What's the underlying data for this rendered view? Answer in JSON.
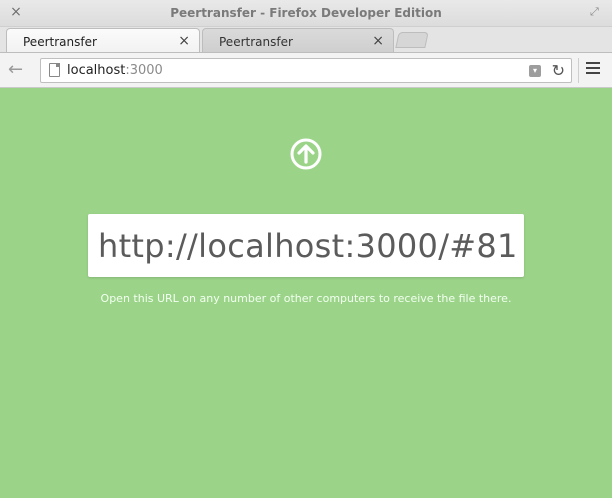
{
  "window": {
    "title": "Peertransfer - Firefox Developer Edition",
    "close_glyph": "×",
    "maximize_glyph": "⤢"
  },
  "tabs": [
    {
      "label": "Peertransfer",
      "close": "×",
      "active": true
    },
    {
      "label": "Peertransfer",
      "close": "×",
      "active": false
    }
  ],
  "navbar": {
    "back_glyph": "←",
    "url_host": "localhost",
    "url_port": ":3000",
    "dropdown_glyph": "▾",
    "reload_glyph": "↻"
  },
  "content": {
    "background": "#9bd489",
    "share_url": "http://localhost:3000/#81",
    "hint": "Open this URL on any number of other computers to receive the file there."
  },
  "icons": {
    "upload": "arrow-up-circle-icon",
    "page": "page-icon"
  }
}
